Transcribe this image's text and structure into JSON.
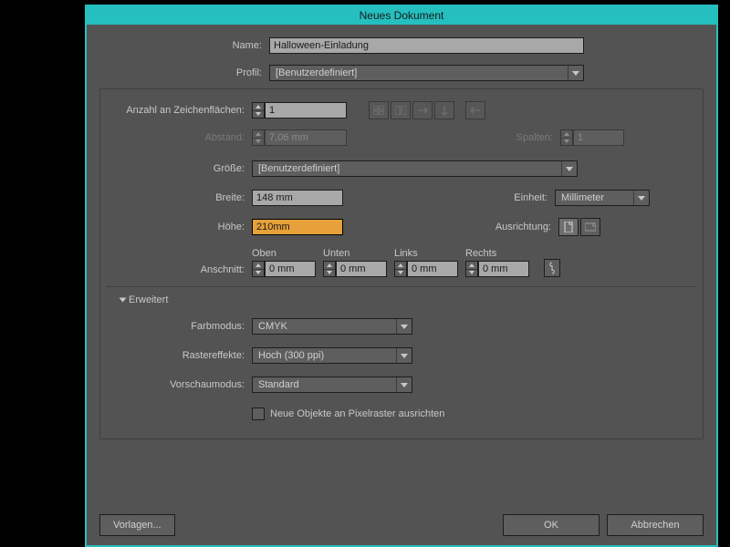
{
  "title": "Neues Dokument",
  "labels": {
    "name": "Name:",
    "profil": "Profil:",
    "artboards": "Anzahl an Zeichenflächen:",
    "abstand": "Abstand:",
    "spalten": "Spalten:",
    "groesse": "Größe:",
    "breite": "Breite:",
    "hoehe": "Höhe:",
    "einheit": "Einheit:",
    "ausrichtung": "Ausrichtung:",
    "anschnitt": "Anschnitt:",
    "erweitert": "Erweitert",
    "farbmodus": "Farbmodus:",
    "rastereffekte": "Rastereffekte:",
    "vorschaumodus": "Vorschaumodus:",
    "pixelraster": "Neue Objekte an Pixelraster ausrichten"
  },
  "values": {
    "name": "Halloween-Einladung",
    "profil": "[Benutzerdefiniert]",
    "artboards": "1",
    "abstand": "7,06 mm",
    "spalten": "1",
    "groesse": "[Benutzerdefiniert]",
    "breite": "148 mm",
    "hoehe": "210mm",
    "einheit": "Millimeter",
    "farbmodus": "CMYK",
    "raster": "Hoch (300 ppi)",
    "vorschau": "Standard"
  },
  "bleed": {
    "oben_label": "Oben",
    "unten_label": "Unten",
    "links_label": "Links",
    "rechts_label": "Rechts",
    "oben": "0 mm",
    "unten": "0 mm",
    "links": "0 mm",
    "rechts": "0 mm"
  },
  "buttons": {
    "vorlagen": "Vorlagen...",
    "ok": "OK",
    "abbrechen": "Abbrechen"
  }
}
